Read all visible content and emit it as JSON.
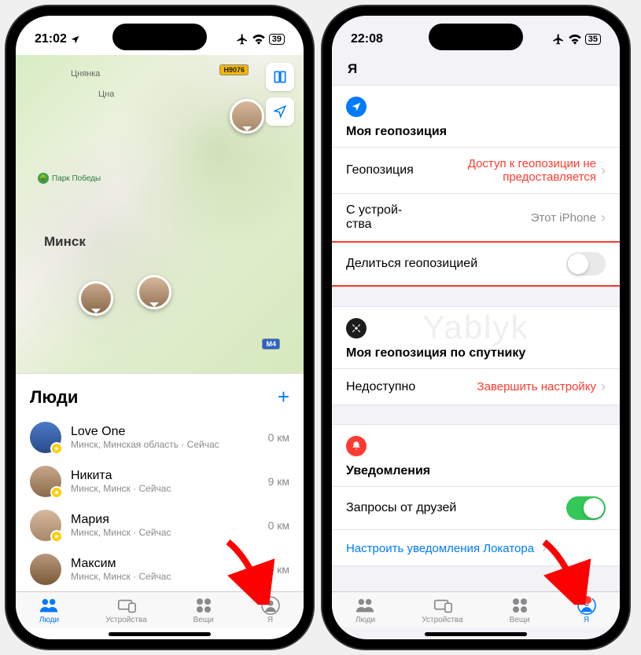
{
  "phone1": {
    "status": {
      "time": "21:02",
      "battery": "39"
    },
    "map": {
      "city": "Минск",
      "label_tsna": "Цна",
      "label_tsnyanka": "Цнянка",
      "badge_h9076": "H9076",
      "badge_m4": "M4",
      "park": "Парк Победы"
    },
    "sheet": {
      "title": "Люди",
      "people": [
        {
          "name": "Love One",
          "sub": "Минск, Минская область · Сейчас",
          "dist": "0 км"
        },
        {
          "name": "Никита",
          "sub": "Минск, Минск · Сейчас",
          "dist": "9 км"
        },
        {
          "name": "Мария",
          "sub": "Минск, Минск · Сейчас",
          "dist": "0 км"
        },
        {
          "name": "Максим",
          "sub": "Минск, Минск · Сейчас",
          "dist": "0 км"
        }
      ]
    },
    "tabs": {
      "people": "Люди",
      "devices": "Устройства",
      "items": "Вещи",
      "me": "Я"
    }
  },
  "phone2": {
    "status": {
      "time": "22:08",
      "battery": "35"
    },
    "nav_title": "Я",
    "sec1": {
      "title": "Моя геопозиция",
      "row_location_label": "Геопозиция",
      "row_location_value": "Доступ к геопозиции не предоставляется",
      "row_device_label": "С устрой-\nства",
      "row_device_value": "Этот iPhone",
      "row_share_label": "Делиться геопозицией"
    },
    "sec2": {
      "title": "Моя геопозиция по спутнику",
      "row_unavail_label": "Недоступно",
      "row_unavail_value": "Завершить настройку"
    },
    "sec3": {
      "title": "Уведомления",
      "row_friends_label": "Запросы от друзей",
      "link": "Настроить уведомления Локатора"
    },
    "tabs": {
      "people": "Люди",
      "devices": "Устройства",
      "items": "Вещи",
      "me": "Я"
    }
  },
  "watermark": "Yablyk"
}
